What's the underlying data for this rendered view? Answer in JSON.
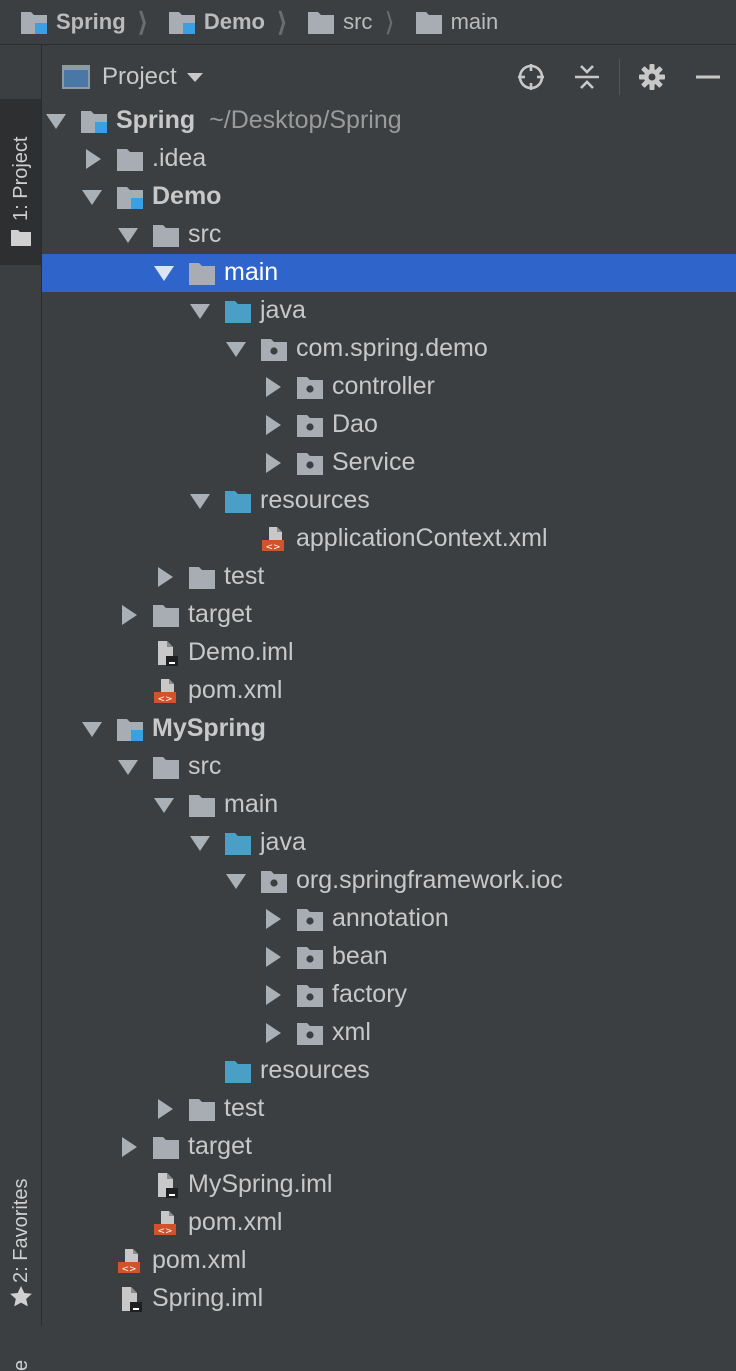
{
  "breadcrumb": [
    {
      "label": "Spring",
      "bold": true,
      "icon": "module-folder-icon"
    },
    {
      "label": "Demo",
      "bold": true,
      "icon": "module-folder-icon"
    },
    {
      "label": "src",
      "bold": false,
      "icon": "folder-icon"
    },
    {
      "label": "main",
      "bold": false,
      "icon": "folder-icon"
    }
  ],
  "sidebar": {
    "project_tab": "1: Project",
    "favorites_tab": "2: Favorites",
    "structure_tab_fragment": "e"
  },
  "panel": {
    "title": "Project",
    "tools": [
      "locate-icon",
      "collapse-all-icon",
      "gear-icon",
      "hide-icon"
    ]
  },
  "tree": [
    {
      "label": "Spring",
      "extra": "~/Desktop/Spring",
      "depth": 0,
      "expand": "down",
      "icon": "module",
      "bold": true
    },
    {
      "label": ".idea",
      "depth": 1,
      "expand": "right",
      "icon": "folder"
    },
    {
      "label": "Demo",
      "depth": 1,
      "expand": "down",
      "icon": "module",
      "bold": true
    },
    {
      "label": "src",
      "depth": 2,
      "expand": "down",
      "icon": "folder"
    },
    {
      "label": "main",
      "depth": 3,
      "expand": "down",
      "icon": "folder",
      "selected": true
    },
    {
      "label": "java",
      "depth": 4,
      "expand": "down",
      "icon": "source"
    },
    {
      "label": "com.spring.demo",
      "depth": 5,
      "expand": "down",
      "icon": "package"
    },
    {
      "label": "controller",
      "depth": 6,
      "expand": "right",
      "icon": "package"
    },
    {
      "label": "Dao",
      "depth": 6,
      "expand": "right",
      "icon": "package"
    },
    {
      "label": "Service",
      "depth": 6,
      "expand": "right",
      "icon": "package"
    },
    {
      "label": "resources",
      "depth": 4,
      "expand": "down",
      "icon": "resources"
    },
    {
      "label": "applicationContext.xml",
      "depth": 5,
      "expand": "none",
      "icon": "xml"
    },
    {
      "label": "test",
      "depth": 3,
      "expand": "right",
      "icon": "folder"
    },
    {
      "label": "target",
      "depth": 2,
      "expand": "right",
      "icon": "folder"
    },
    {
      "label": "Demo.iml",
      "depth": 2,
      "expand": "none",
      "icon": "iml"
    },
    {
      "label": "pom.xml",
      "depth": 2,
      "expand": "none",
      "icon": "xml"
    },
    {
      "label": "MySpring",
      "depth": 1,
      "expand": "down",
      "icon": "module",
      "bold": true
    },
    {
      "label": "src",
      "depth": 2,
      "expand": "down",
      "icon": "folder"
    },
    {
      "label": "main",
      "depth": 3,
      "expand": "down",
      "icon": "folder"
    },
    {
      "label": "java",
      "depth": 4,
      "expand": "down",
      "icon": "source"
    },
    {
      "label": "org.springframework.ioc",
      "depth": 5,
      "expand": "down",
      "icon": "package"
    },
    {
      "label": "annotation",
      "depth": 6,
      "expand": "right",
      "icon": "package"
    },
    {
      "label": "bean",
      "depth": 6,
      "expand": "right",
      "icon": "package"
    },
    {
      "label": "factory",
      "depth": 6,
      "expand": "right",
      "icon": "package"
    },
    {
      "label": "xml",
      "depth": 6,
      "expand": "right",
      "icon": "package"
    },
    {
      "label": "resources",
      "depth": 4,
      "expand": "none",
      "icon": "resources"
    },
    {
      "label": "test",
      "depth": 3,
      "expand": "right",
      "icon": "folder"
    },
    {
      "label": "target",
      "depth": 2,
      "expand": "right",
      "icon": "folder"
    },
    {
      "label": "MySpring.iml",
      "depth": 2,
      "expand": "none",
      "icon": "iml"
    },
    {
      "label": "pom.xml",
      "depth": 2,
      "expand": "none",
      "icon": "xml"
    },
    {
      "label": "pom.xml",
      "depth": 1,
      "expand": "none",
      "icon": "xml"
    },
    {
      "label": "Spring.iml",
      "depth": 1,
      "expand": "none",
      "icon": "iml"
    }
  ]
}
